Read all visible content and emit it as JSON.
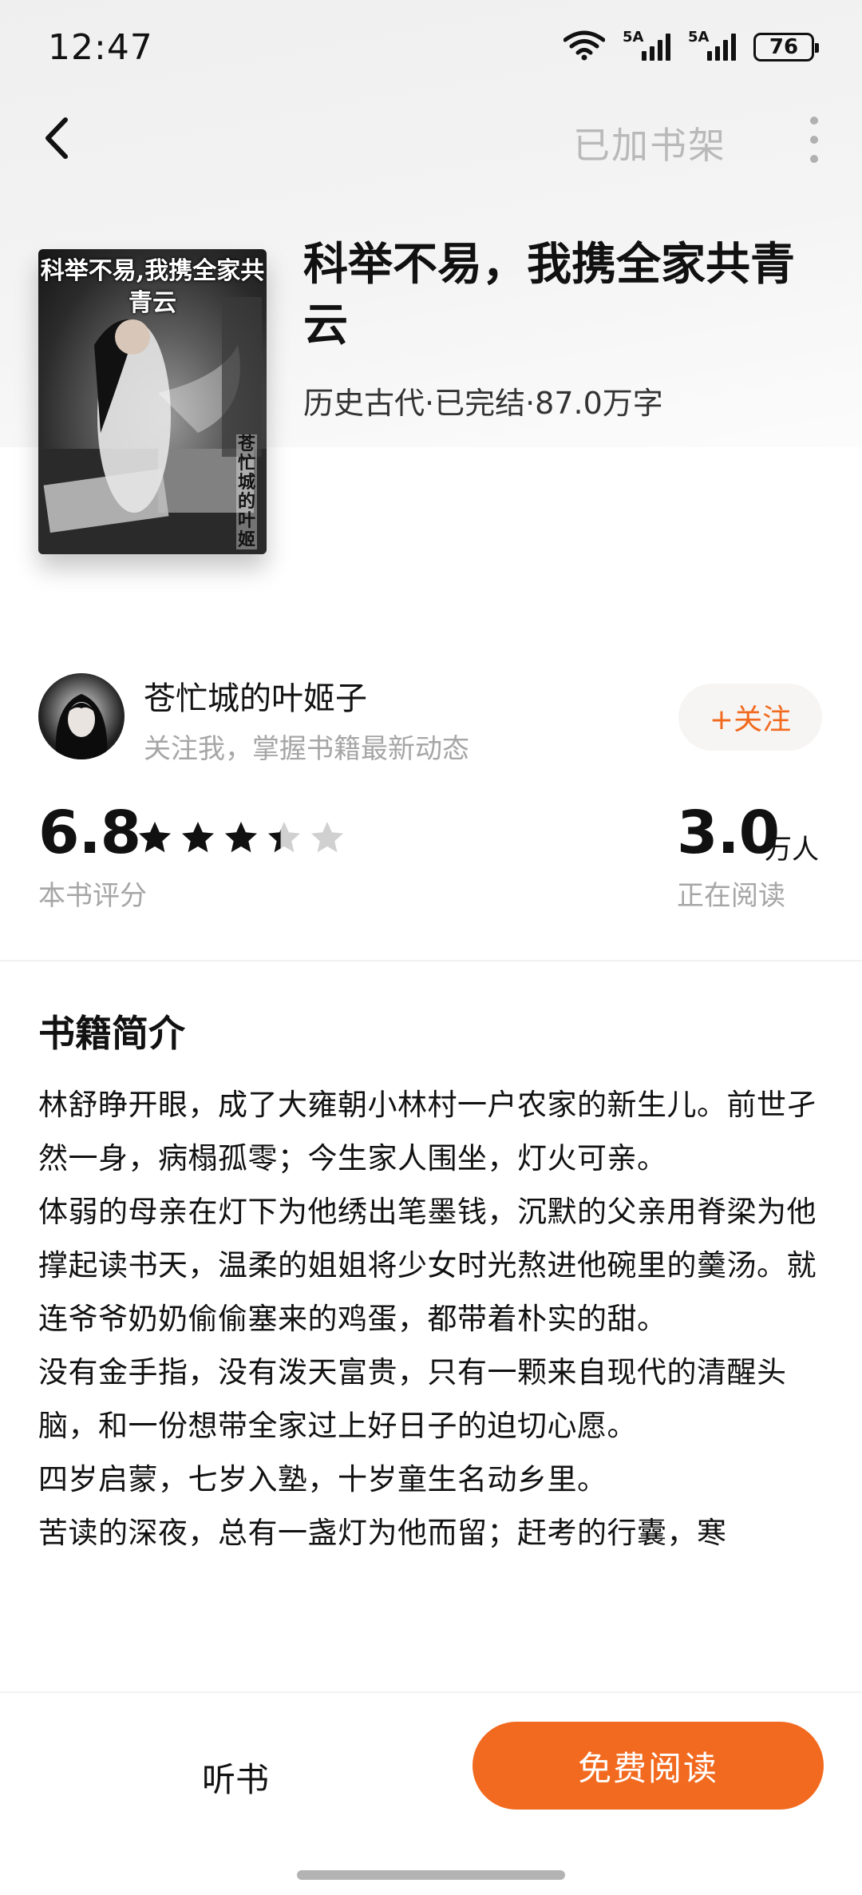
{
  "status_bar": {
    "time": "12:47",
    "battery": "76",
    "signal_1_label": "5A",
    "signal_2_label": "5A",
    "icons": [
      "wifi-icon",
      "signal-icon",
      "signal-icon",
      "battery-icon"
    ]
  },
  "nav": {
    "back_icon": "chevron-left-icon",
    "shelf_label": "已加书架",
    "more_icon": "more-vertical-icon"
  },
  "book": {
    "cover_title": "科举不易,我携全家共青云",
    "cover_author": "苍忙城的叶姬",
    "title": "科举不易，我携全家共青云",
    "meta": "历史古代·已完结·87.0万字"
  },
  "author": {
    "name": "苍忙城的叶姬子",
    "subtitle": "关注我，掌握书籍最新动态",
    "follow_label": "+关注"
  },
  "stats": {
    "rating": "6.8",
    "rating_label": "本书评分",
    "stars": 3.4,
    "readers": "3.0",
    "readers_unit": "万人",
    "readers_label": "正在阅读"
  },
  "intro": {
    "heading": "书籍简介",
    "paragraphs": [
      "林舒睁开眼，成了大雍朝小林村一户农家的新生儿。前世孑然一身，病榻孤零；今生家人围坐，灯火可亲。",
      "体弱的母亲在灯下为他绣出笔墨钱，沉默的父亲用脊梁为他撑起读书天，温柔的姐姐将少女时光熬进他碗里的羹汤。就连爷爷奶奶偷偷塞来的鸡蛋，都带着朴实的甜。",
      "没有金手指，没有泼天富贵，只有一颗来自现代的清醒头脑，和一份想带全家过上好日子的迫切心愿。",
      "四岁启蒙，七岁入塾，十岁童生名动乡里。",
      "苦读的深夜，总有一盏灯为他而留；赶考的行囊，寒"
    ]
  },
  "bottom": {
    "listen_label": "听书",
    "read_label": "免费阅读"
  },
  "colors": {
    "accent": "#f26a1f",
    "muted": "#a6a6a6",
    "star_filled": "#111111",
    "star_empty": "#d0d0d0"
  }
}
